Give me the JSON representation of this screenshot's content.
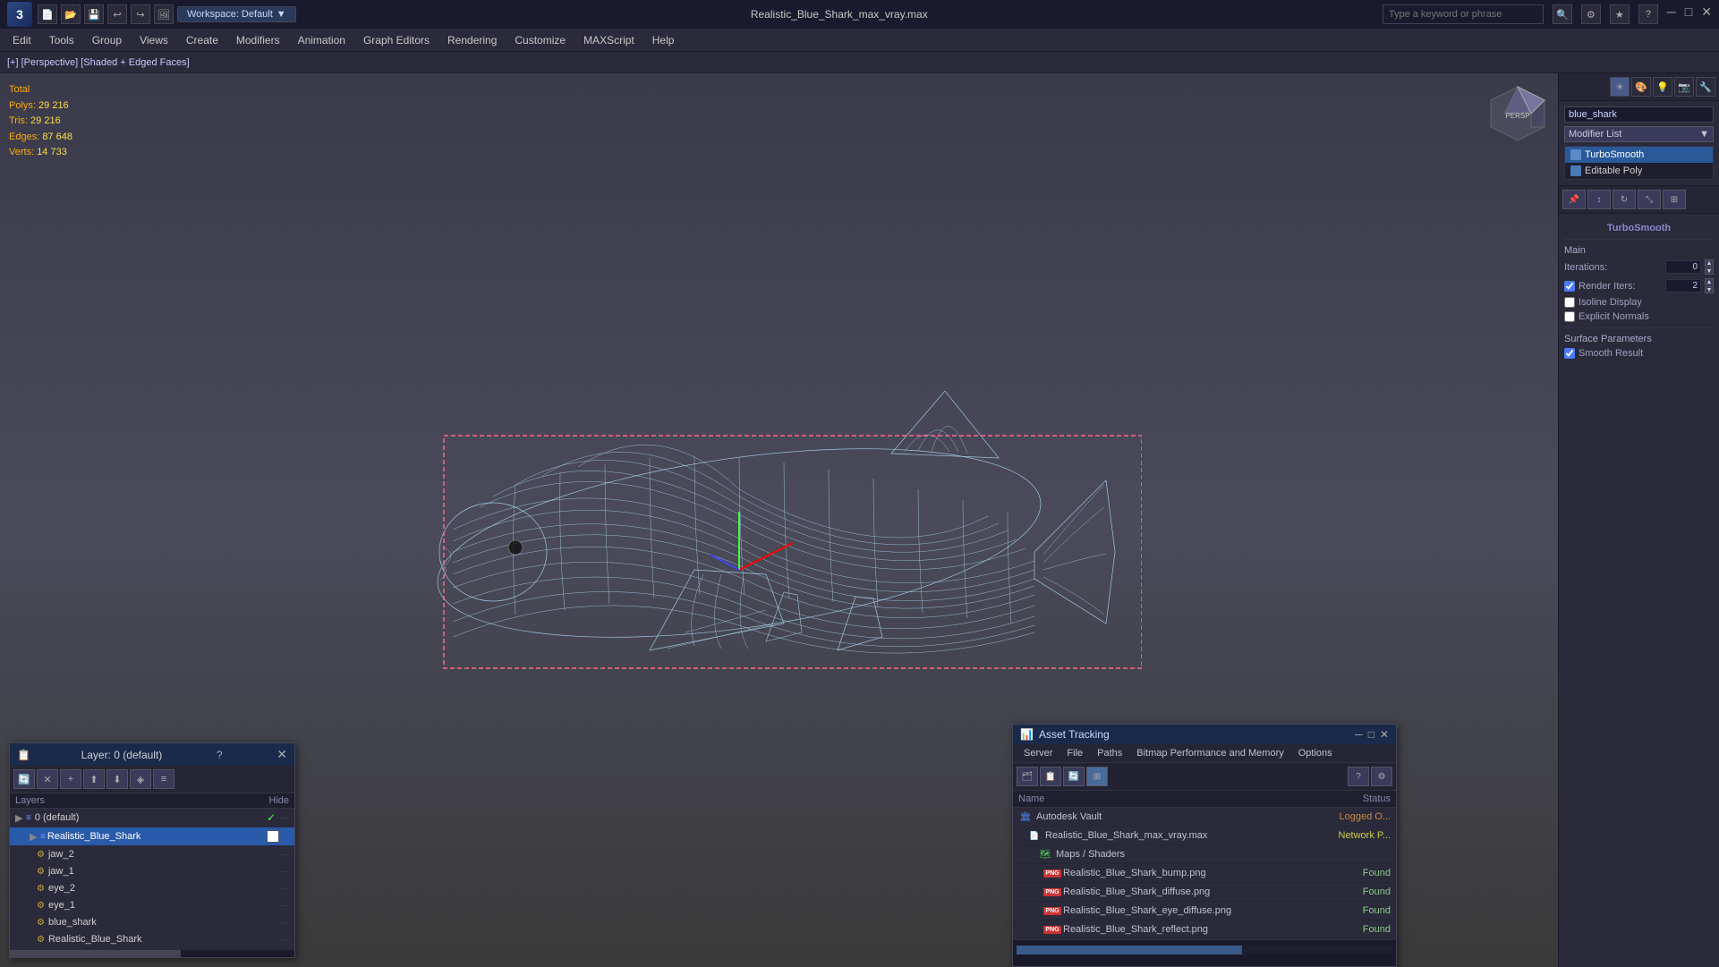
{
  "title_bar": {
    "logo": "3",
    "file_title": "Realistic_Blue_Shark_max_vray.max",
    "workspace_label": "Workspace: Default",
    "search_placeholder": "Type a keyword or phrase",
    "window_controls": [
      "minimize",
      "restore",
      "close"
    ]
  },
  "menu_bar": {
    "items": [
      "Edit",
      "Tools",
      "Group",
      "Views",
      "Create",
      "Modifiers",
      "Animation",
      "Graph Editors",
      "Rendering",
      "Customize",
      "MAXScript",
      "Help"
    ]
  },
  "viewport": {
    "label": "[+] [Perspective] [Shaded + Edged Faces]",
    "stats": {
      "total_label": "Total",
      "polys_label": "Polys:",
      "polys_value": "29 216",
      "tris_label": "Tris:",
      "tris_value": "29 216",
      "edges_label": "Edges:",
      "edges_value": "87 648",
      "verts_label": "Verts:",
      "verts_value": "14 733"
    }
  },
  "right_panel": {
    "object_name": "blue_shark",
    "modifier_list_label": "Modifier List",
    "modifier_stack": [
      {
        "name": "TurboSmooth",
        "active": true
      },
      {
        "name": "Editable Poly",
        "active": false
      }
    ],
    "panel_section": "TurboSmooth",
    "main_label": "Main",
    "iterations_label": "Iterations:",
    "iterations_value": "0",
    "render_iters_label": "Render Iters:",
    "render_iters_value": "2",
    "isoline_label": "Isoline Display",
    "explicit_label": "Explicit Normals",
    "surface_params_label": "Surface Parameters",
    "smooth_result_label": "Smooth Result"
  },
  "layer_panel": {
    "title": "Layer: 0 (default)",
    "help": "?",
    "layers_col": "Layers",
    "hide_col": "Hide",
    "items": [
      {
        "name": "0 (default)",
        "level": 0,
        "selected": false,
        "checked": true
      },
      {
        "name": "Realistic_Blue_Shark",
        "level": 1,
        "selected": true,
        "checked": false
      },
      {
        "name": "jaw_2",
        "level": 2,
        "selected": false,
        "checked": false
      },
      {
        "name": "jaw_1",
        "level": 2,
        "selected": false,
        "checked": false
      },
      {
        "name": "eye_2",
        "level": 2,
        "selected": false,
        "checked": false
      },
      {
        "name": "eye_1",
        "level": 2,
        "selected": false,
        "checked": false
      },
      {
        "name": "blue_shark",
        "level": 2,
        "selected": false,
        "checked": false
      },
      {
        "name": "Realistic_Blue_Shark",
        "level": 2,
        "selected": false,
        "checked": false
      }
    ]
  },
  "asset_panel": {
    "title": "Asset Tracking",
    "menu_items": [
      "Server",
      "File",
      "Paths",
      "Bitmap Performance and Memory",
      "Options"
    ],
    "columns": {
      "name": "Name",
      "status": "Status"
    },
    "items": [
      {
        "type": "vault",
        "name": "Autodesk Vault",
        "status": "Logged O...",
        "indent": 0
      },
      {
        "type": "file",
        "name": "Realistic_Blue_Shark_max_vray.max",
        "status": "Network P...",
        "indent": 1
      },
      {
        "type": "maps",
        "name": "Maps / Shaders",
        "status": "",
        "indent": 2
      },
      {
        "type": "png",
        "name": "Realistic_Blue_Shark_bump.png",
        "status": "Found",
        "indent": 3
      },
      {
        "type": "png",
        "name": "Realistic_Blue_Shark_diffuse.png",
        "status": "Found",
        "indent": 3
      },
      {
        "type": "png",
        "name": "Realistic_Blue_Shark_eye_diffuse.png",
        "status": "Found",
        "indent": 3
      },
      {
        "type": "png",
        "name": "Realistic_Blue_Shark_reflect.png",
        "status": "Found",
        "indent": 3
      }
    ]
  }
}
